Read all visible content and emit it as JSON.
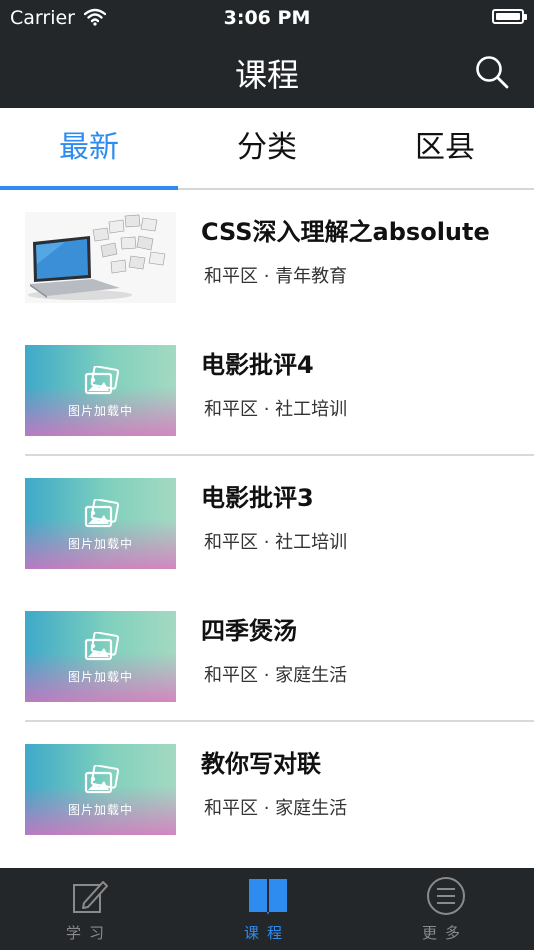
{
  "status_bar": {
    "carrier": "Carrier",
    "time": "3:06 PM"
  },
  "nav": {
    "title": "课程",
    "search_icon": "search-icon"
  },
  "tabs": [
    {
      "label": "最新",
      "active": true
    },
    {
      "label": "分类",
      "active": false
    },
    {
      "label": "区县",
      "active": false
    }
  ],
  "courses": [
    {
      "title": "CSS深入理解之absolute",
      "meta": "和平区 · 青年教育",
      "thumb": "laptop-photo"
    },
    {
      "title": "电影批评4",
      "meta": "和平区 · 社工培训",
      "thumb_text": "图片加载中"
    },
    {
      "title": "电影批评3",
      "meta": "和平区 · 社工培训",
      "thumb_text": "图片加载中"
    },
    {
      "title": "四季煲汤",
      "meta": "和平区 · 家庭生活",
      "thumb_text": "图片加载中"
    },
    {
      "title": "教你写对联",
      "meta": "和平区 · 家庭生活",
      "thumb_text": "图片加载中"
    }
  ],
  "tabbar": [
    {
      "label": "学习",
      "icon": "edit-icon",
      "active": false
    },
    {
      "label": "课程",
      "icon": "book-icon",
      "active": true
    },
    {
      "label": "更多",
      "icon": "menu-circle-icon",
      "active": false
    }
  ],
  "colors": {
    "bar_bg": "#23272a",
    "accent": "#2e8cf0"
  }
}
